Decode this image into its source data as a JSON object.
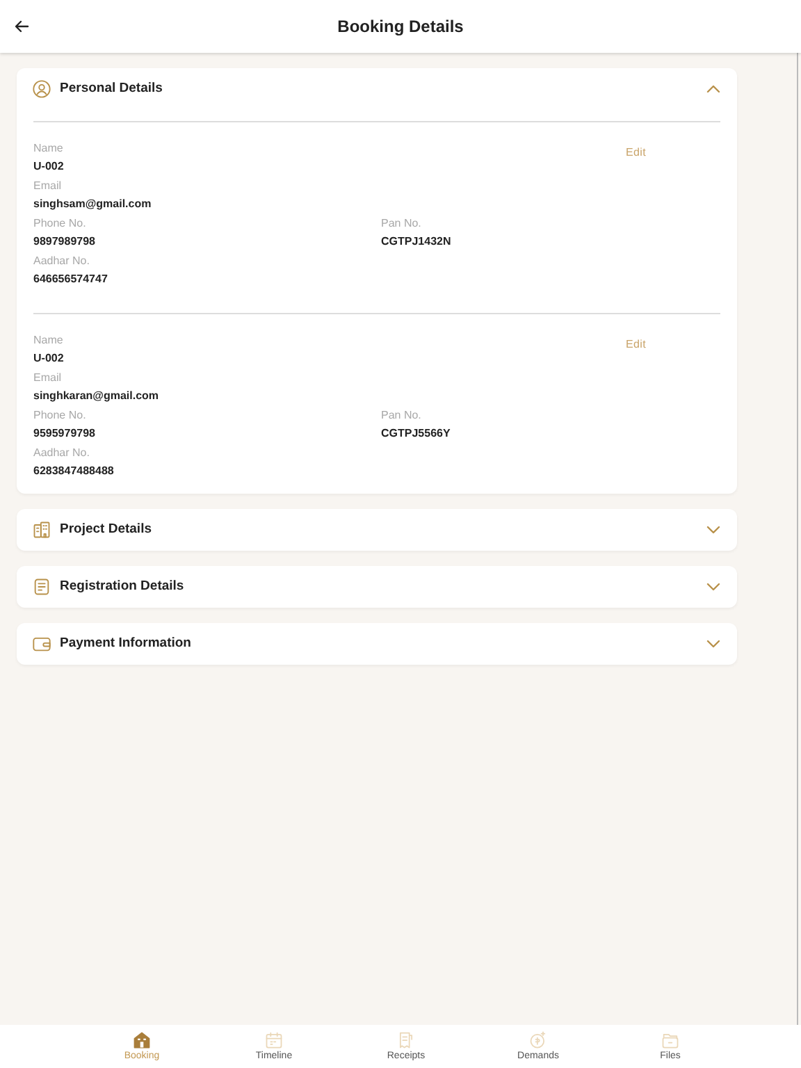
{
  "header": {
    "title": "Booking Details"
  },
  "sections": [
    {
      "title": "Personal Details",
      "kind": "person",
      "expanded": true,
      "people": [
        {
          "name_label": "Name",
          "name": "U-002",
          "edit": "Edit",
          "email_label": "Email",
          "email": "singhsam@gmail.com",
          "phone_label": "Phone No.",
          "phone": "9897989798",
          "pan_label": "Pan No.",
          "pan": "CGTPJ1432N",
          "aadhar_label": "Aadhar No.",
          "aadhar": "646656574747"
        },
        {
          "name_label": "Name",
          "name": "U-002",
          "edit": "Edit",
          "email_label": "Email",
          "email": "singhkaran@gmail.com",
          "phone_label": "Phone No.",
          "phone": "9595979798",
          "pan_label": "Pan No.",
          "pan": "CGTPJ5566Y",
          "aadhar_label": "Aadhar No.",
          "aadhar": "6283847488488"
        }
      ]
    },
    {
      "title": "Project Details",
      "kind": "building",
      "expanded": false
    },
    {
      "title": "Registration Details",
      "kind": "document",
      "expanded": false
    },
    {
      "title": "Payment Information",
      "kind": "wallet",
      "expanded": false
    }
  ],
  "nav": [
    {
      "label": "Booking",
      "kind": "house",
      "selected": true
    },
    {
      "label": "Timeline",
      "kind": "calendar",
      "selected": false
    },
    {
      "label": "Receipts",
      "kind": "receipt",
      "selected": false
    },
    {
      "label": "Demands",
      "kind": "coin",
      "selected": false
    },
    {
      "label": "Files",
      "kind": "folder",
      "selected": false
    }
  ]
}
